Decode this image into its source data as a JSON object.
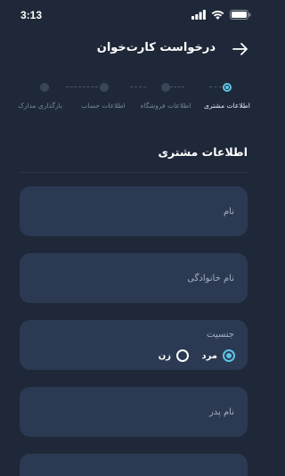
{
  "status_bar": {
    "time": "3:13"
  },
  "header": {
    "title": "درخواست کارت‌خوان"
  },
  "stepper": {
    "steps": [
      {
        "label": "اطلاعات مشتری",
        "active": true
      },
      {
        "label": "اطلاعات فروشگاه",
        "active": false
      },
      {
        "label": "اطلاعات حساب",
        "active": false
      },
      {
        "label": "بارگذاری مدارک",
        "active": false
      }
    ]
  },
  "section": {
    "title": "اطلاعات مشتری"
  },
  "form": {
    "first_name": {
      "placeholder": "نام"
    },
    "last_name": {
      "placeholder": "نام خانوادگی"
    },
    "gender": {
      "label": "جنسیت",
      "options": [
        {
          "label": "مرد",
          "checked": true
        },
        {
          "label": "زن",
          "checked": false
        }
      ]
    },
    "father_name": {
      "placeholder": "نام پدر"
    }
  },
  "colors": {
    "background": "#1e2838",
    "field": "#2b3a52",
    "accent": "#5ec3e5"
  }
}
